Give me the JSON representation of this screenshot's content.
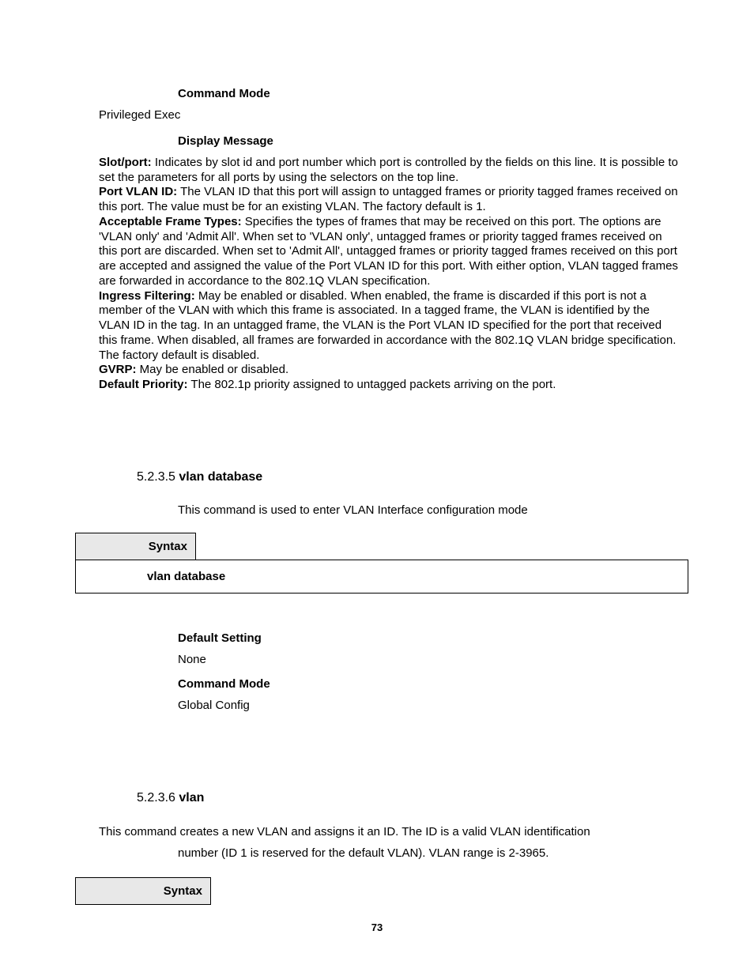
{
  "commandModeHeading": "Command Mode",
  "commandModeValue": "Privileged Exec",
  "displayMessageHeading": "Display Message",
  "defs": {
    "slotport": {
      "label": "Slot/port:",
      "text": " Indicates by slot id and port number which port is controlled by the fields on this line. It is possible to set the parameters for all ports by using the selectors on the top line."
    },
    "portvlanid": {
      "label": "Port VLAN ID:",
      "text": " The VLAN ID that this port will assign to untagged frames or priority tagged frames received on this port. The value must be for an existing VLAN. The factory default is 1."
    },
    "acceptable": {
      "label": "Acceptable Frame Types:",
      "text": " Specifies the types of frames that may be received on this port. The options are 'VLAN only' and 'Admit All'. When set to 'VLAN only', untagged frames or priority tagged frames received on this port are discarded. When set to 'Admit All', untagged frames or priority tagged frames received on this port are accepted and assigned the value of the Port VLAN ID for this port. With either option, VLAN tagged frames are forwarded in accordance to the 802.1Q VLAN specification."
    },
    "ingress": {
      "label": "Ingress Filtering:",
      "text": " May be enabled or disabled. When enabled, the frame is discarded if this port is not a member of the VLAN with which this frame is associated. In a tagged frame, the VLAN is identified by the VLAN ID in the tag. In an untagged frame, the VLAN is the Port VLAN ID specified for the port that received this frame. When disabled, all frames are forwarded in accordance with the 802.1Q VLAN bridge specification. The factory default is disabled."
    },
    "gvrp": {
      "label": "GVRP:",
      "text": " May be enabled or disabled."
    },
    "defaultPriority": {
      "label": "Default Priority:",
      "text": " The 802.1p priority assigned to untagged packets arriving on the port."
    }
  },
  "sec5235": {
    "num": "5.2.3.5 ",
    "name": "vlan database",
    "desc": "This command is used to enter VLAN Interface configuration mode",
    "syntaxLabel": "Syntax",
    "syntaxCmd": "vlan database",
    "defaultSettingLabel": "Default Setting",
    "defaultSettingValue": "None",
    "cmdModeLabel": "Command Mode",
    "cmdModeValue": "Global Config"
  },
  "sec5236": {
    "num": "5.2.3.6 ",
    "name": "vlan",
    "descLine1": "This command creates a new VLAN and assigns it an ID. The ID is a valid VLAN identification",
    "descLine2": "number (ID 1 is reserved for the default VLAN). VLAN range is 2-3965.",
    "syntaxLabel": "Syntax"
  },
  "pageNumber": "73"
}
